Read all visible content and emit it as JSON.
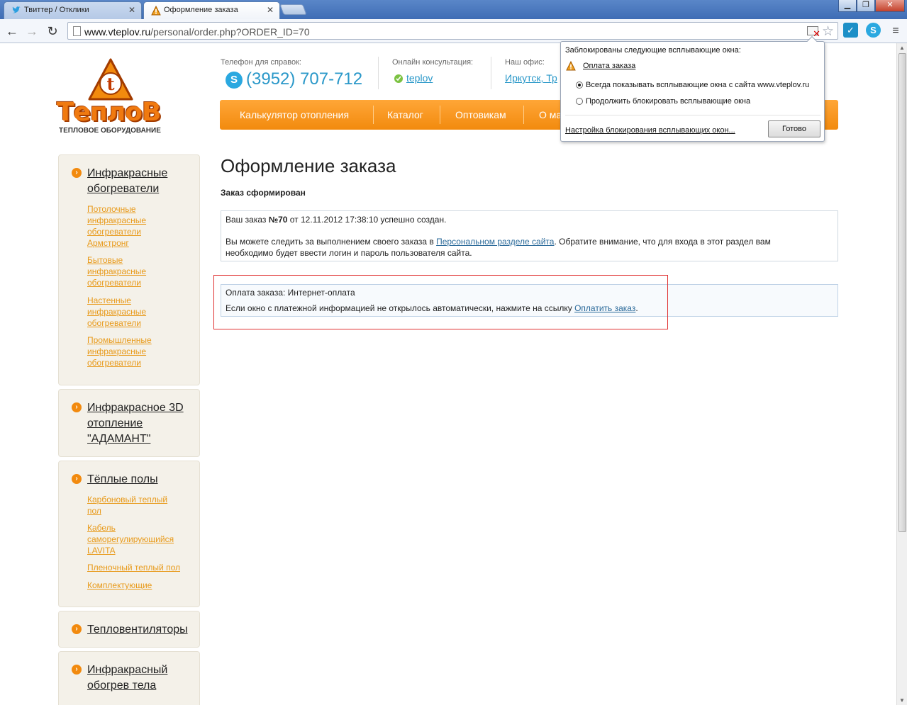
{
  "browser": {
    "tabs": [
      {
        "label": "Твиттер / Отклики",
        "icon": "twitter-icon"
      },
      {
        "label": "Оформление заказа",
        "icon": "warning-icon"
      }
    ],
    "url_domain": "www.vteplov.ru",
    "url_path": "/personal/order.php?ORDER_ID=70",
    "window_controls": {
      "minimize": "▁",
      "restore": "❐",
      "close": "✕"
    }
  },
  "popup": {
    "title": "Заблокированы следующие всплывающие окна:",
    "blocked_link": "Оплата заказа",
    "option_always": "Всегда показывать всплывающие окна с сайта www.vteplov.ru",
    "option_block": "Продолжить блокировать всплывающие окна",
    "settings_link": "Настройка блокирования всплывающих окон...",
    "done_button": "Готово"
  },
  "header": {
    "logo_text": "ТеплоВ",
    "logo_subtitle": "ТЕПЛОВОЕ ОБОРУДОВАНИЕ",
    "phone_label": "Телефон для справок:",
    "phone": "(3952) 707-712",
    "consult_label": "Онлайн консультация:",
    "consult_link": "teplov",
    "office_label": "Наш офис:",
    "office_link": "Иркутск, Тр"
  },
  "nav": [
    "Калькулятор отопления",
    "Каталог",
    "Оптовикам",
    "О ма"
  ],
  "sidebar": [
    {
      "head": [
        "Инфракрасные",
        "обогреватели"
      ],
      "subs": [
        [
          "Потолочные",
          "инфракрасные",
          "обогреватели",
          "Армстронг"
        ],
        [
          "Бытовые",
          "инфракрасные",
          "обогреватели"
        ],
        [
          "Настенные",
          "инфракрасные",
          "обогреватели"
        ],
        [
          "Промышленные",
          "инфракрасные",
          "обогреватели"
        ]
      ]
    },
    {
      "head": [
        "Инфракрасное 3D",
        "отопление",
        "\"АДАМАНТ\""
      ],
      "subs": []
    },
    {
      "head": [
        "Тёплые полы"
      ],
      "subs": [
        [
          "Карбоновый теплый",
          "пол"
        ],
        [
          "Кабель",
          "саморегулирующийся",
          "LAVITA"
        ],
        [
          "Пленочный теплый пол"
        ],
        [
          "Комплектующие"
        ]
      ]
    },
    {
      "head": [
        "Тепловентиляторы"
      ],
      "subs": []
    },
    {
      "head": [
        "Инфракрасный",
        "обогрев тела"
      ],
      "subs": []
    }
  ],
  "main": {
    "title": "Оформление заказа",
    "status": "Заказ сформирован",
    "order": {
      "prefix": "Ваш заказ ",
      "number": "№70",
      "suffix": " от 12.11.2012 17:38:10 успешно создан.",
      "track_prefix": "Вы можете следить за выполнением своего заказа в ",
      "track_link": "Персональном разделе сайта",
      "track_suffix": ". Обратите внимание, что для входа в этот раздел вам",
      "track_line2": "необходимо будет ввести логин и пароль пользователя сайта."
    },
    "payment": {
      "method": "Оплата заказа: Интернет-оплата",
      "hint_prefix": "Если окно с платежной информацией не открылось автоматически, нажмите на ссылку ",
      "pay_link": "Оплатить заказ",
      "hint_suffix": "."
    }
  }
}
